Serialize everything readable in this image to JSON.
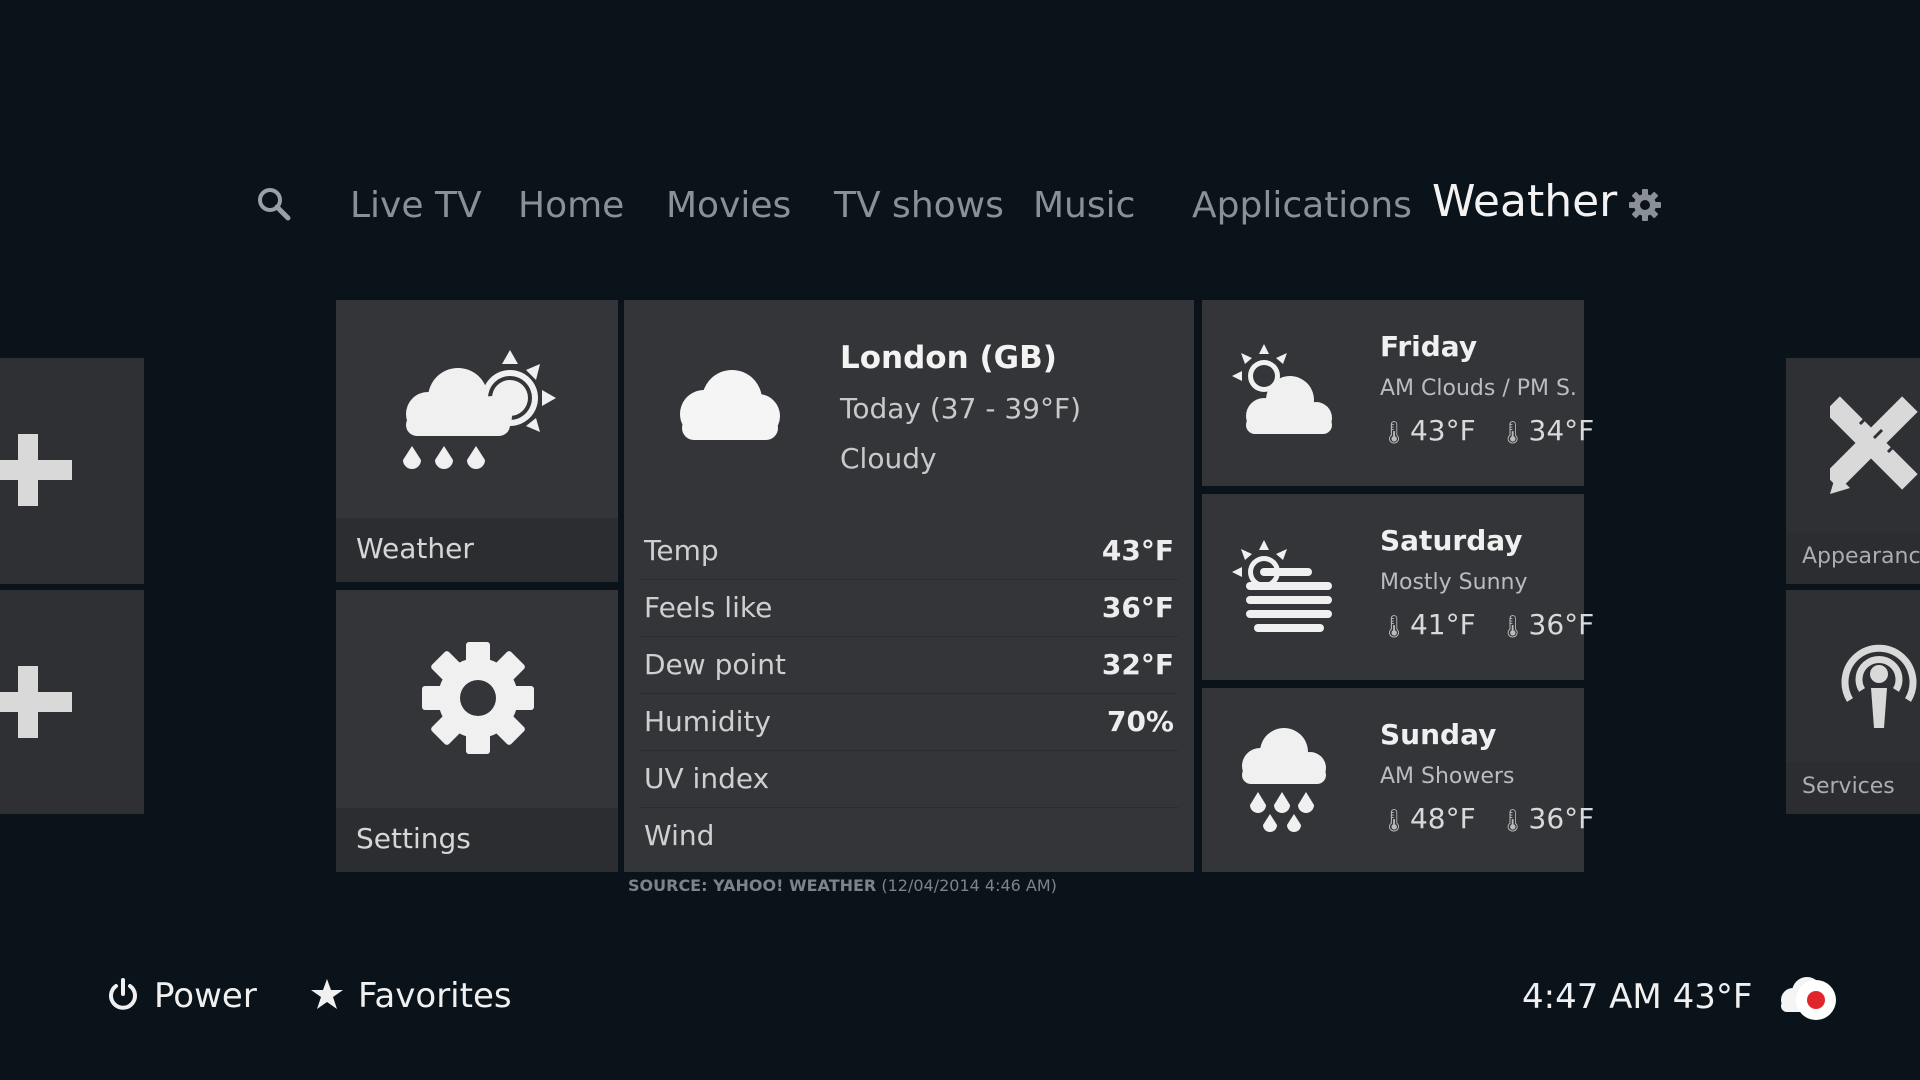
{
  "nav": {
    "items": [
      "Live TV",
      "Home",
      "Movies",
      "TV shows",
      "Music",
      "Applications",
      "Weather"
    ],
    "active": "Weather"
  },
  "tiles": {
    "weather_label": "Weather",
    "settings_label": "Settings",
    "appearance_label": "Appearance",
    "services_label": "Services"
  },
  "current": {
    "city": "London (GB)",
    "today": "Today (37 - 39°F)",
    "condition": "Cloudy",
    "rows": [
      {
        "label": "Temp",
        "value": "43°F"
      },
      {
        "label": "Feels like",
        "value": "36°F"
      },
      {
        "label": "Dew point",
        "value": "32°F"
      },
      {
        "label": "Humidity",
        "value": "70%"
      },
      {
        "label": "UV index",
        "value": ""
      },
      {
        "label": "Wind",
        "value": ""
      }
    ]
  },
  "source": {
    "label": "SOURCE: YAHOO! WEATHER",
    "date": "(12/04/2014 4:46 AM)"
  },
  "forecast": [
    {
      "day": "Friday",
      "outlook": "AM Clouds / PM S...",
      "high": "43°F",
      "low": "34°F",
      "icon": "partly-cloudy-icon"
    },
    {
      "day": "Saturday",
      "outlook": "Mostly Sunny",
      "high": "41°F",
      "low": "36°F",
      "icon": "sun-haze-icon"
    },
    {
      "day": "Sunday",
      "outlook": "AM Showers",
      "high": "48°F",
      "low": "36°F",
      "icon": "showers-icon"
    }
  ],
  "bottom": {
    "power": "Power",
    "favorites": "Favorites",
    "time": "4:47 AM",
    "temp": "43°F"
  },
  "colors": {
    "background": "#0b131a",
    "tile": "#333538",
    "record": "#e0262a"
  }
}
